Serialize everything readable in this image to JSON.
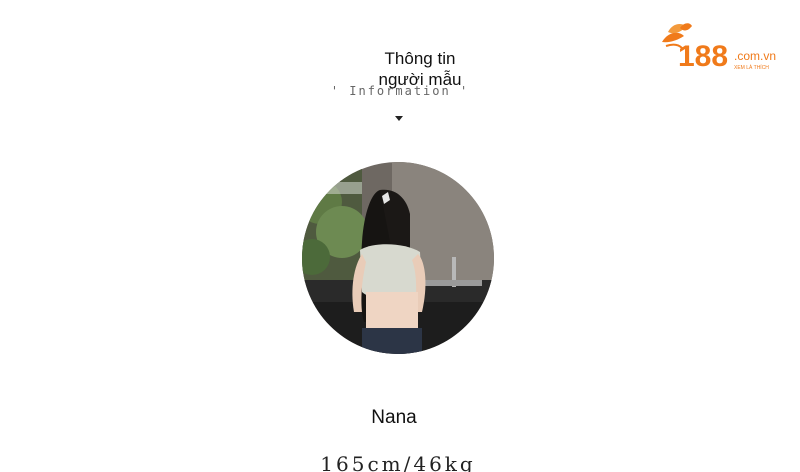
{
  "brand": {
    "logo_number": "188",
    "logo_domain": ".com.vn",
    "logo_tagline": "XEM LÀ THÍCH",
    "accent_color": "#f07a1a"
  },
  "section": {
    "title": "Thông tin người mẫu",
    "subtitle": "' Information '",
    "arrow_icon": "caret-down-icon"
  },
  "model": {
    "photo_description_icon": "model-photo",
    "name": "Nana",
    "stats": "165cm/46kg"
  }
}
